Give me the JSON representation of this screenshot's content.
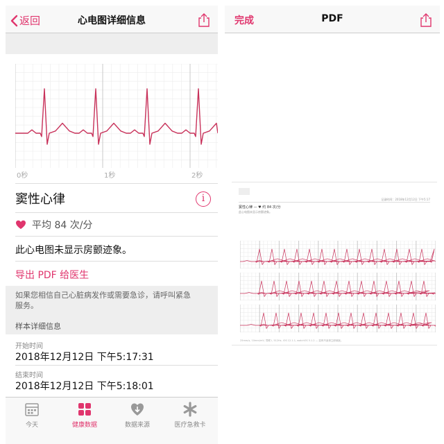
{
  "left_screen": {
    "nav": {
      "back_label": "返回",
      "title": "心电图详细信息"
    },
    "ecg": {
      "time_labels": [
        "0秒",
        "1秒",
        "2秒"
      ]
    },
    "result": {
      "rhythm": "窦性心律",
      "avg_hr": "平均 84 次/分",
      "no_afib": "此心电图未显示房颤迹象。",
      "export_pdf": "导出 PDF 给医生"
    },
    "warning": "如果您相信自己心脏病发作或需要急诊，请呼叫紧急服务。",
    "sample_header": "样本详细信息",
    "details": [
      {
        "label": "开始时间",
        "value": "2018年12月12日 下午5:17:31"
      },
      {
        "label": "结束时间",
        "value": "2018年12月12日 下午5:18:01"
      }
    ],
    "tabs": [
      {
        "label": "今天",
        "icon": "calendar-icon"
      },
      {
        "label": "健康数据",
        "icon": "grid-icon"
      },
      {
        "label": "数据来源",
        "icon": "heart-download-icon"
      },
      {
        "label": "医疗急救卡",
        "icon": "asterisk-icon"
      }
    ],
    "active_tab": "健康数据"
  },
  "right_screen": {
    "nav": {
      "done_label": "完成",
      "title": "PDF"
    },
    "pdf": {
      "title": "窦性心律 — ♥ 约 84 次/分",
      "subtitle": "此心电图未显示房颤迹象。",
      "header_note": "记录时间：2018年12月12日 下午5:17",
      "footer_note": "25mm/s, 10mm/mV, 导联 I, 512Hz, iOS 12.1.1, watchOS 5.1.2 — 如有不适请立即就医。"
    }
  },
  "colors": {
    "accent": "#e0356d",
    "ecg_trace": "#c8315a",
    "grid_major": "#c8c8c8",
    "grid_minor": "#ececec",
    "panel_bg": "#eeeeee"
  }
}
